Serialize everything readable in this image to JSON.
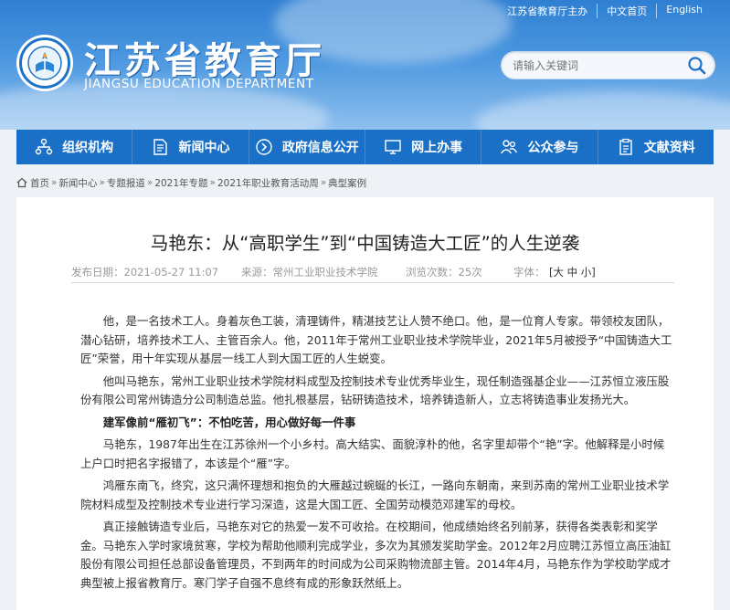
{
  "topbar": {
    "sponsor": "江苏省教育厅主办",
    "home_cn": "中文首页",
    "english": "English"
  },
  "brand": {
    "title": "江苏省教育厅",
    "subtitle": "JIANGSU EDUCATION DEPARTMENT"
  },
  "search": {
    "placeholder": "请输入关键词"
  },
  "nav": {
    "items": [
      {
        "label": "组织机构",
        "icon": "org-chart-icon"
      },
      {
        "label": "新闻中心",
        "icon": "document-icon"
      },
      {
        "label": "政府信息公开",
        "icon": "info-arrow-icon"
      },
      {
        "label": "网上办事",
        "icon": "monitor-icon"
      },
      {
        "label": "公众参与",
        "icon": "people-icon"
      },
      {
        "label": "文献资料",
        "icon": "clipboard-icon"
      }
    ]
  },
  "breadcrumb": {
    "items": [
      "首页",
      "新闻中心",
      "专题报道",
      "2021年专题",
      "2021年职业教育活动周",
      "典型案例"
    ]
  },
  "article": {
    "title": "马艳东：从“高职学生”到“中国铸造大工匠”的人生逆袭",
    "publish_date": "发布日期：2021-05-27 11:07",
    "source": "来源：常州工业职业技术学院",
    "views": "浏览次数：25次",
    "font_size_label": "字体：",
    "font_sizes": "[大 中 小]",
    "paragraphs": [
      "他，是一名技术工人。身着灰色工装，清理铸件，精湛技艺让人赞不绝口。他，是一位育人专家。带领校友团队，潜心钻研，培养技术工人、主管百余人。他，2011年于常州工业职业技术学院毕业，2021年5月被授予“中国铸造大工匠”荣誉，用十年实现从基层一线工人到大国工匠的人生蜕变。",
      "他叫马艳东，常州工业职业技术学院材料成型及控制技术专业优秀毕业生，现任制造强基企业——江苏恒立液压股份有限公司常州铸造分公司制造总监。他扎根基层，钻研铸造技术，培养铸造新人，立志将铸造事业发扬光大。",
      "建军像前“雁初飞”：不怕吃苦，用心做好每一件事",
      "马艳东，1987年出生在江苏徐州一个小乡村。高大结实、面貌淳朴的他，名字里却带个“艳”字。他解释是小时候上户口时把名字报错了，本该是个“雁”字。",
      "鸿雁东南飞，终究，这只满怀理想和抱负的大雁越过蜿蜒的长江，一路向东朝南，来到苏南的常州工业职业技术学院材料成型及控制技术专业进行学习深造，这是大国工匠、全国劳动模范邓建军的母校。",
      "真正接触铸造专业后，马艳东对它的热爱一发不可收拾。在校期间，他成绩始终名列前茅，获得各类表彰和奖学金。马艳东入学时家境贫寒，学校为帮助他顺利完成学业，多次为其颁发奖助学金。2012年2月应聘江苏恒立高压油缸股份有限公司担任总部设备管理员，不到两年的时间成为公司采购物流部主管。2014年4月，马艳东作为学校助学成才典型被上报省教育厅。寒门学子自强不息终有成的形象跃然纸上。"
    ]
  }
}
